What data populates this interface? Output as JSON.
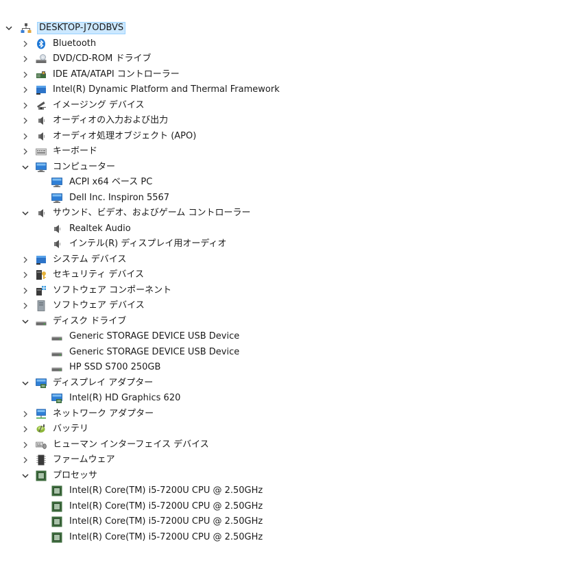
{
  "tree": [
    {
      "level": 0,
      "expander": "expanded",
      "icon": "computer-tree-root-icon",
      "label": "DESKTOP-J7ODBVS",
      "selected": true
    },
    {
      "level": 1,
      "expander": "collapsed",
      "icon": "bluetooth-icon",
      "label": "Bluetooth"
    },
    {
      "level": 1,
      "expander": "collapsed",
      "icon": "dvd-drive-icon",
      "label": "DVD/CD-ROM ドライブ"
    },
    {
      "level": 1,
      "expander": "collapsed",
      "icon": "ide-controller-icon",
      "label": "IDE ATA/ATAPI コントローラー"
    },
    {
      "level": 1,
      "expander": "collapsed",
      "icon": "system-device-icon",
      "label": "Intel(R) Dynamic Platform and Thermal Framework"
    },
    {
      "level": 1,
      "expander": "collapsed",
      "icon": "camera-icon",
      "label": "イメージング デバイス"
    },
    {
      "level": 1,
      "expander": "collapsed",
      "icon": "speaker-icon",
      "label": "オーディオの入力および出力"
    },
    {
      "level": 1,
      "expander": "collapsed",
      "icon": "speaker-icon",
      "label": "オーディオ処理オブジェクト (APO)"
    },
    {
      "level": 1,
      "expander": "collapsed",
      "icon": "keyboard-icon",
      "label": "キーボード"
    },
    {
      "level": 1,
      "expander": "expanded",
      "icon": "monitor-icon",
      "label": "コンピューター"
    },
    {
      "level": 2,
      "expander": "none",
      "icon": "monitor-icon",
      "label": "ACPI x64 ベース PC"
    },
    {
      "level": 2,
      "expander": "none",
      "icon": "monitor-icon",
      "label": "Dell Inc. Inspiron 5567"
    },
    {
      "level": 1,
      "expander": "expanded",
      "icon": "speaker-icon",
      "label": "サウンド、ビデオ、およびゲーム コントローラー"
    },
    {
      "level": 2,
      "expander": "none",
      "icon": "speaker-icon",
      "label": "Realtek Audio"
    },
    {
      "level": 2,
      "expander": "none",
      "icon": "speaker-icon",
      "label": "インテル(R) ディスプレイ用オーディオ"
    },
    {
      "level": 1,
      "expander": "collapsed",
      "icon": "system-device-icon",
      "label": "システム デバイス"
    },
    {
      "level": 1,
      "expander": "collapsed",
      "icon": "security-device-icon",
      "label": "セキュリティ デバイス"
    },
    {
      "level": 1,
      "expander": "collapsed",
      "icon": "software-component-icon",
      "label": "ソフトウェア コンポーネント"
    },
    {
      "level": 1,
      "expander": "collapsed",
      "icon": "software-device-icon",
      "label": "ソフトウェア デバイス"
    },
    {
      "level": 1,
      "expander": "expanded",
      "icon": "disk-drive-icon",
      "label": "ディスク ドライブ"
    },
    {
      "level": 2,
      "expander": "none",
      "icon": "disk-drive-icon",
      "label": "Generic STORAGE DEVICE USB Device"
    },
    {
      "level": 2,
      "expander": "none",
      "icon": "disk-drive-icon",
      "label": "Generic STORAGE DEVICE USB Device"
    },
    {
      "level": 2,
      "expander": "none",
      "icon": "disk-drive-icon",
      "label": "HP SSD S700 250GB"
    },
    {
      "level": 1,
      "expander": "expanded",
      "icon": "display-adapter-icon",
      "label": "ディスプレイ アダプター"
    },
    {
      "level": 2,
      "expander": "none",
      "icon": "display-adapter-icon",
      "label": "Intel(R) HD Graphics 620"
    },
    {
      "level": 1,
      "expander": "collapsed",
      "icon": "network-adapter-icon",
      "label": "ネットワーク アダプター"
    },
    {
      "level": 1,
      "expander": "collapsed",
      "icon": "battery-icon",
      "label": "バッテリ"
    },
    {
      "level": 1,
      "expander": "collapsed",
      "icon": "hid-icon",
      "label": "ヒューマン インターフェイス デバイス"
    },
    {
      "level": 1,
      "expander": "collapsed",
      "icon": "firmware-icon",
      "label": "ファームウェア"
    },
    {
      "level": 1,
      "expander": "expanded",
      "icon": "processor-icon",
      "label": "プロセッサ"
    },
    {
      "level": 2,
      "expander": "none",
      "icon": "processor-icon",
      "label": "Intel(R) Core(TM) i5-7200U CPU @ 2.50GHz"
    },
    {
      "level": 2,
      "expander": "none",
      "icon": "processor-icon",
      "label": "Intel(R) Core(TM) i5-7200U CPU @ 2.50GHz"
    },
    {
      "level": 2,
      "expander": "none",
      "icon": "processor-icon",
      "label": "Intel(R) Core(TM) i5-7200U CPU @ 2.50GHz"
    },
    {
      "level": 2,
      "expander": "none",
      "icon": "processor-icon",
      "label": "Intel(R) Core(TM) i5-7200U CPU @ 2.50GHz"
    }
  ],
  "colors": {
    "selection_bg": "#cce8ff",
    "selection_border": "#99d1ff",
    "text": "#1a1a1a",
    "chevron": "#555555"
  }
}
